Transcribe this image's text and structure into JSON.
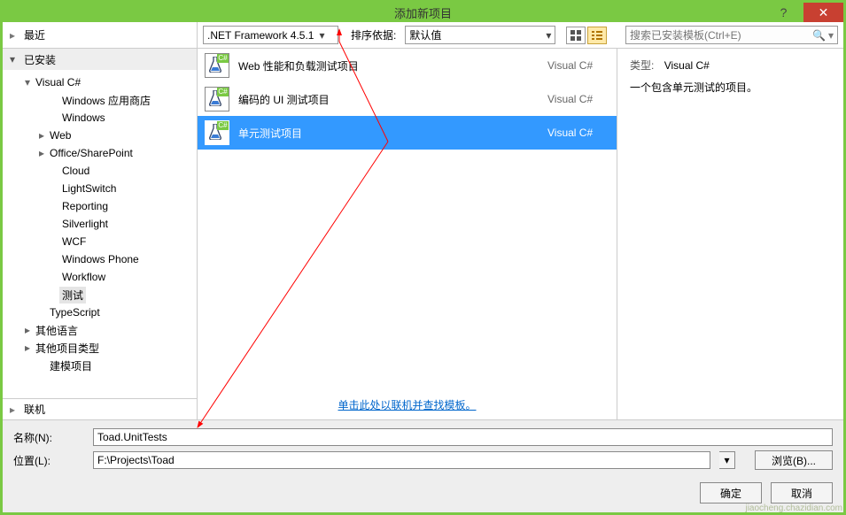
{
  "window": {
    "title": "添加新项目"
  },
  "left": {
    "recent": "最近",
    "installed": "已安装",
    "online": "联机",
    "tree": [
      {
        "label": "Visual C#",
        "depth": 1,
        "arrow": "▾"
      },
      {
        "label": "Windows 应用商店",
        "depth": 3,
        "arrow": ""
      },
      {
        "label": "Windows",
        "depth": 3,
        "arrow": ""
      },
      {
        "label": "Web",
        "depth": 2,
        "arrow": "▸"
      },
      {
        "label": "Office/SharePoint",
        "depth": 2,
        "arrow": "▸"
      },
      {
        "label": "Cloud",
        "depth": 3,
        "arrow": ""
      },
      {
        "label": "LightSwitch",
        "depth": 3,
        "arrow": ""
      },
      {
        "label": "Reporting",
        "depth": 3,
        "arrow": ""
      },
      {
        "label": "Silverlight",
        "depth": 3,
        "arrow": ""
      },
      {
        "label": "WCF",
        "depth": 3,
        "arrow": ""
      },
      {
        "label": "Windows Phone",
        "depth": 3,
        "arrow": ""
      },
      {
        "label": "Workflow",
        "depth": 3,
        "arrow": ""
      },
      {
        "label": "测试",
        "depth": 3,
        "arrow": "",
        "selected": true
      },
      {
        "label": "TypeScript",
        "depth": 2,
        "arrow": ""
      },
      {
        "label": "其他语言",
        "depth": 1,
        "arrow": "▸"
      },
      {
        "label": "其他项目类型",
        "depth": 1,
        "arrow": "▸"
      },
      {
        "label": "建模项目",
        "depth": 2,
        "arrow": ""
      }
    ]
  },
  "filters": {
    "framework": ".NET Framework 4.5.1",
    "sort_label": "排序依据:",
    "sort_value": "默认值",
    "search_placeholder": "搜索已安装模板(Ctrl+E)"
  },
  "templates": [
    {
      "name": "Web 性能和负载测试项目",
      "lang": "Visual C#",
      "selected": false
    },
    {
      "name": "编码的 UI 测试项目",
      "lang": "Visual C#",
      "selected": false
    },
    {
      "name": "单元测试项目",
      "lang": "Visual C#",
      "selected": true
    }
  ],
  "online_link": "单击此处以联机并查找模板。",
  "detail": {
    "type_label": "类型:",
    "type_value": "Visual C#",
    "description": "一个包含单元测试的项目。"
  },
  "form": {
    "name_label": "名称(N):",
    "name_value": "Toad.UnitTests",
    "location_label": "位置(L):",
    "location_value": "F:\\Projects\\Toad",
    "browse": "浏览(B)..."
  },
  "buttons": {
    "ok": "确定",
    "cancel": "取消"
  },
  "watermark": "jiaocheng.chazidian.com"
}
